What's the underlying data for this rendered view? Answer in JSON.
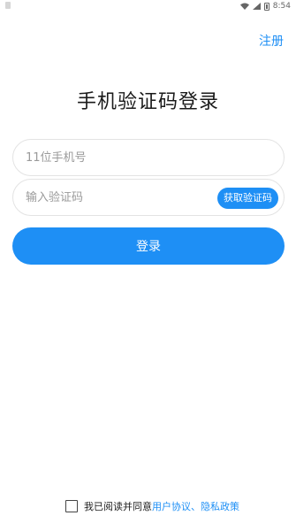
{
  "status_bar": {
    "time": "8:54"
  },
  "header": {
    "register_label": "注册"
  },
  "main": {
    "title": "手机验证码登录",
    "phone_placeholder": "11位手机号",
    "code_placeholder": "输入验证码",
    "get_code_label": "获取验证码",
    "login_label": "登录"
  },
  "agreement": {
    "prefix": "我已阅读并同意",
    "user_agreement": "用户协议",
    "separator": "、",
    "privacy_policy": "隐私政策",
    "checked": false
  },
  "colors": {
    "accent": "#1e8ff5"
  }
}
